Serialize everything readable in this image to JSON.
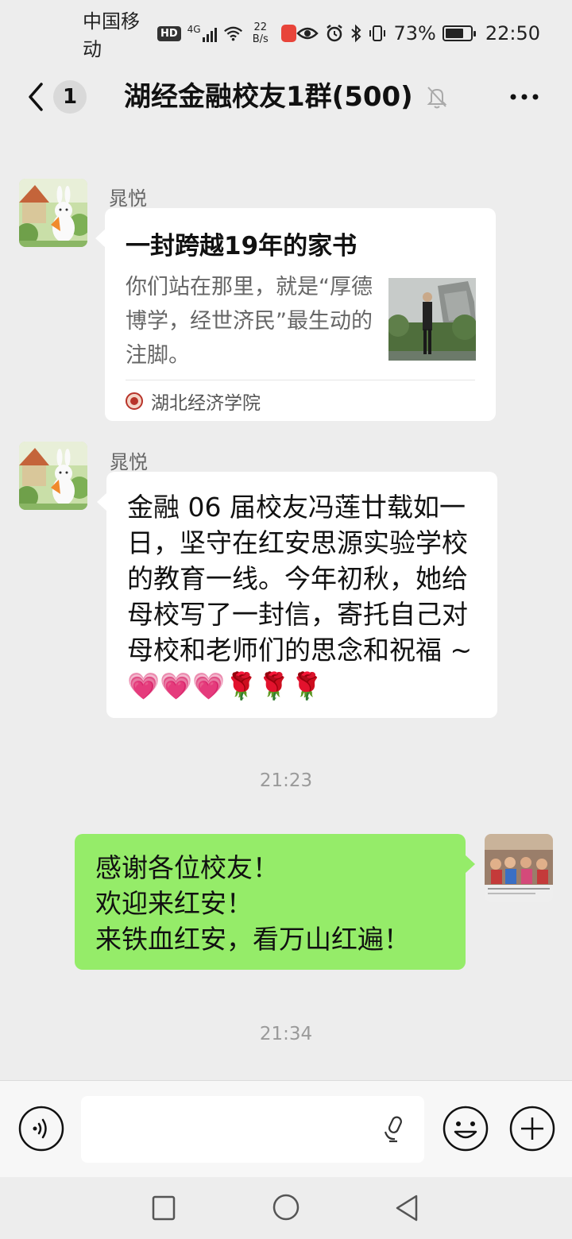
{
  "status": {
    "carrier": "中国移动",
    "hd": "HD",
    "signal_label": "4G",
    "net_speed_value": "22",
    "net_speed_unit": "B/s",
    "battery_pct": "73%",
    "battery_level": 0.73,
    "time": "22:50"
  },
  "header": {
    "unread": "1",
    "title": "湖经金融校友1群(500)"
  },
  "messages": {
    "link_card": {
      "sender": "晁悦",
      "title": "一封跨越19年的家书",
      "desc": "你们站在那里，就是“厚德博学，经世济民”最生动的注脚。",
      "source": "湖北经济学院"
    },
    "text1": {
      "sender": "晁悦",
      "text": "金融 06 届校友冯莲廿载如一日，坚守在红安思源实验学校的教育一线。今年初秋，她给母校写了一封信，寄托自己对母校和老师们的思念和祝福 ~ 💗💗💗🌹🌹🌹"
    },
    "time1": "21:23",
    "mine": {
      "line1": "感谢各位校友！",
      "line2": "欢迎来红安！",
      "line3": "来铁血红安，看万山红遍！"
    },
    "time2": "21:34"
  },
  "input": {
    "placeholder": ""
  },
  "colors": {
    "background": "#ededed",
    "my_bubble": "#95ec69",
    "other_bubble": "#ffffff"
  }
}
